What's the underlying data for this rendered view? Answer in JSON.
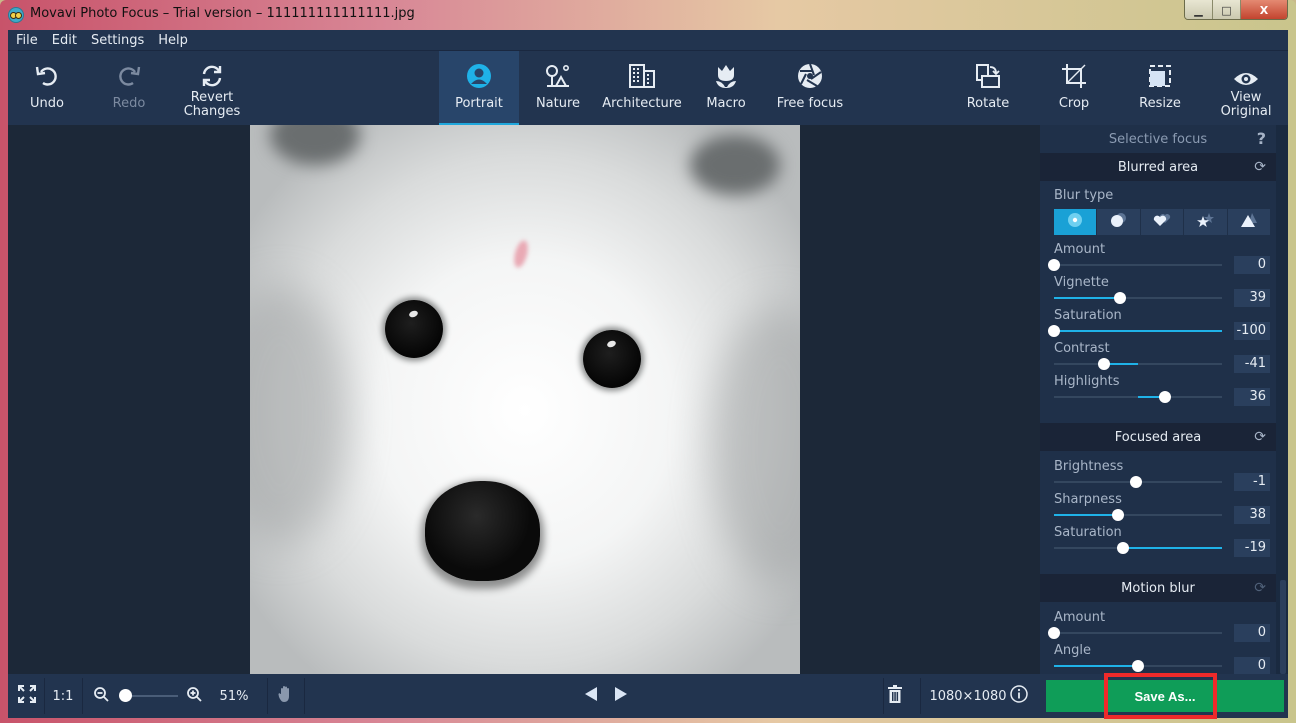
{
  "window": {
    "title": "Movavi Photo Focus – Trial version – 111111111111111.jpg",
    "controls": {
      "minimize": "▁",
      "maximize": "□",
      "close": "X"
    }
  },
  "menu": [
    "File",
    "Edit",
    "Settings",
    "Help"
  ],
  "toolbar": {
    "undo": "Undo",
    "redo": "Redo",
    "revert_line1": "Revert",
    "revert_line2": "Changes",
    "modes": [
      "Portrait",
      "Nature",
      "Architecture",
      "Macro",
      "Free focus"
    ],
    "active_mode": "Portrait",
    "rotate": "Rotate",
    "crop": "Crop",
    "resize": "Resize",
    "view_line1": "View",
    "view_line2": "Original"
  },
  "panel": {
    "selective_focus": "Selective focus",
    "help_icon": "?",
    "blurred_area": {
      "title": "Blurred area",
      "blur_type_label": "Blur type",
      "blur_types": [
        "circle-bokeh",
        "disc",
        "heart",
        "star",
        "triangle"
      ],
      "active_blur_type": "circle-bokeh",
      "sliders": [
        {
          "label": "Amount",
          "value": "0",
          "fraction": 0.0
        },
        {
          "label": "Vignette",
          "value": "39",
          "fraction": 0.39
        },
        {
          "label": "Saturation",
          "value": "-100",
          "fraction": 0.0
        },
        {
          "label": "Contrast",
          "value": "-41",
          "fraction": 0.3
        },
        {
          "label": "Highlights",
          "value": "36",
          "fraction": 0.66
        }
      ]
    },
    "focused_area": {
      "title": "Focused area",
      "sliders": [
        {
          "label": "Brightness",
          "value": "-1",
          "fraction": 0.49
        },
        {
          "label": "Sharpness",
          "value": "38",
          "fraction": 0.38
        },
        {
          "label": "Saturation",
          "value": "-19",
          "fraction": 0.41
        }
      ]
    },
    "motion_blur": {
      "title": "Motion blur",
      "sliders": [
        {
          "label": "Amount",
          "value": "0",
          "fraction": 0.0
        },
        {
          "label": "Angle",
          "value": "0",
          "fraction": 0.5
        }
      ]
    }
  },
  "bottombar": {
    "one_to_one": "1:1",
    "zoom_percent": "51%",
    "zoom_fraction": 0.05,
    "dimensions": "1080×1080",
    "save_as": "Save As..."
  },
  "colors": {
    "accent": "#1fa7dc",
    "save_green": "#0f9d58",
    "highlight_red": "#ee2a2a"
  }
}
